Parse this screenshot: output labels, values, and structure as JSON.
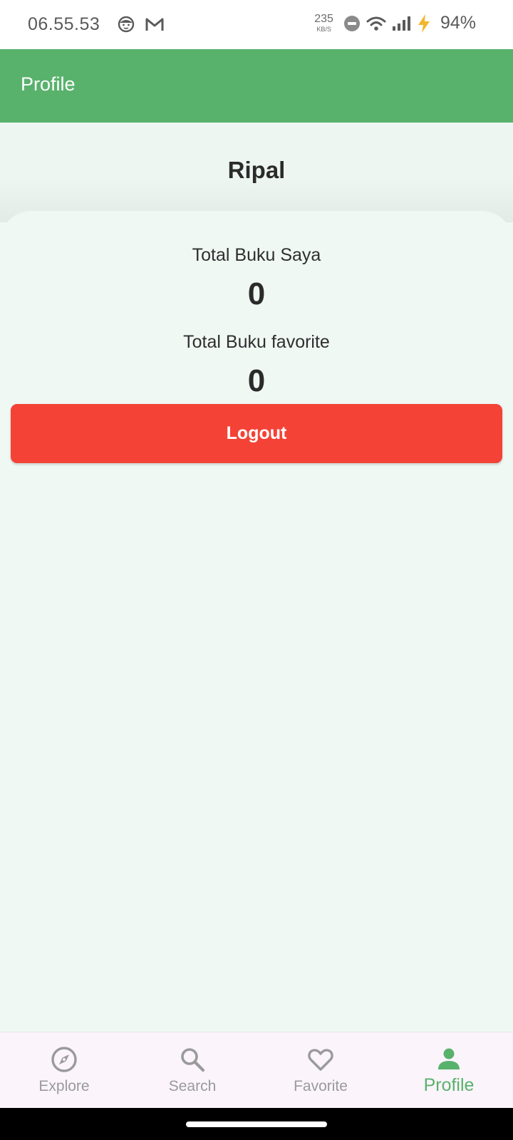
{
  "status_bar": {
    "time": "06.55.53",
    "net_speed_value": "235",
    "net_speed_unit": "KB/S",
    "battery": "94%",
    "icons": [
      "face-icon",
      "gmail-icon",
      "dnd-icon",
      "wifi-icon",
      "signal-icon",
      "charging-icon"
    ]
  },
  "app_bar": {
    "title": "Profile"
  },
  "profile": {
    "name": "Ripal",
    "stats": [
      {
        "label": "Total Buku Saya",
        "value": "0"
      },
      {
        "label": "Total Buku favorite",
        "value": "0"
      }
    ],
    "logout_label": "Logout"
  },
  "bottom_nav": {
    "items": [
      {
        "label": "Explore",
        "icon": "compass-icon",
        "active": false
      },
      {
        "label": "Search",
        "icon": "search-icon",
        "active": false
      },
      {
        "label": "Favorite",
        "icon": "heart-icon",
        "active": false
      },
      {
        "label": "Profile",
        "icon": "person-icon",
        "active": true
      }
    ]
  },
  "colors": {
    "primary": "#58b26c",
    "danger": "#f44236",
    "background": "#f0f8f4",
    "nav_background": "#fbf4fb",
    "inactive": "#9a9a9a"
  }
}
